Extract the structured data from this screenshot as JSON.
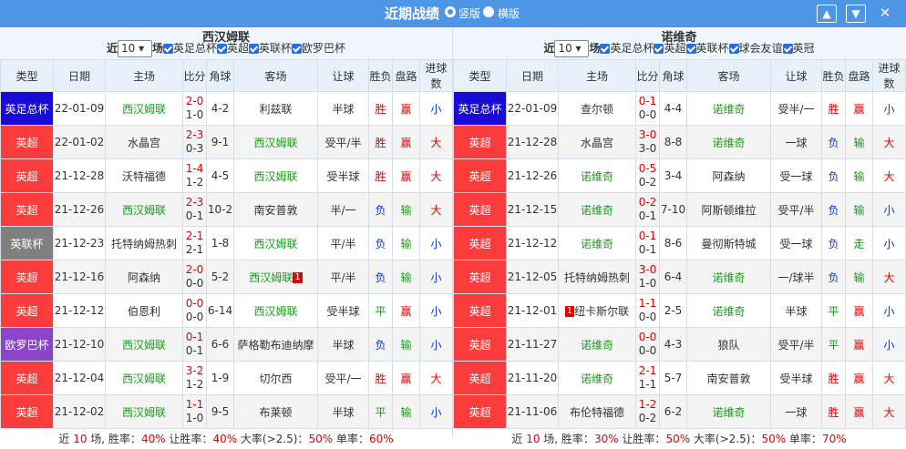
{
  "header": {
    "title": "近期战绩",
    "view_vertical": "竖版",
    "view_horizontal": "横版",
    "btn_up": "▲",
    "btn_down": "▼",
    "btn_close": "✕"
  },
  "columns": [
    "类型",
    "日期",
    "主场",
    "比分",
    "角球",
    "客场",
    "让球",
    "胜负",
    "盘路",
    "进球数"
  ],
  "left": {
    "team": "西汉姆联",
    "filter": {
      "prefix": "近",
      "count": "10",
      "suffix": "场",
      "checks": [
        "英足总杯",
        "英超",
        "英联杯",
        "欧罗巴杯"
      ]
    },
    "rows": [
      {
        "type": "英足总杯",
        "tc": "t-fa",
        "date": "22-01-09",
        "home": "西汉姆联",
        "hg": true,
        "ft": "2-0",
        "ht": "1-0",
        "corner": "4-2",
        "away": "利兹联",
        "ag": false,
        "hc": "半球",
        "wl": "胜",
        "wlc": "redc",
        "pl": "赢",
        "plc": "redc",
        "ou": "小",
        "ouc": "bluec"
      },
      {
        "type": "英超",
        "tc": "t-pl",
        "date": "22-01-02",
        "home": "水晶宫",
        "hg": false,
        "ft": "2-3",
        "ht": "0-3",
        "corner": "9-1",
        "away": "西汉姆联",
        "ag": true,
        "hc": "受平/半",
        "wl": "胜",
        "wlc": "redc",
        "pl": "赢",
        "plc": "redc",
        "ou": "大",
        "ouc": "redc"
      },
      {
        "type": "英超",
        "tc": "t-pl",
        "date": "21-12-28",
        "home": "沃特福德",
        "hg": false,
        "ft": "1-4",
        "ht": "1-2",
        "corner": "4-5",
        "away": "西汉姆联",
        "ag": true,
        "hc": "受半球",
        "wl": "胜",
        "wlc": "redc",
        "pl": "赢",
        "plc": "redc",
        "ou": "大",
        "ouc": "redc"
      },
      {
        "type": "英超",
        "tc": "t-pl",
        "date": "21-12-26",
        "home": "西汉姆联",
        "hg": true,
        "ft": "2-3",
        "ht": "0-1",
        "corner": "10-2",
        "away": "南安普敦",
        "ag": false,
        "hc": "半/一",
        "wl": "负",
        "wlc": "bluec",
        "pl": "输",
        "plc": "greenc",
        "ou": "大",
        "ouc": "redc"
      },
      {
        "type": "英联杯",
        "tc": "t-lc",
        "date": "21-12-23",
        "home": "托特纳姆热刺",
        "hg": false,
        "ft": "2-1",
        "ht": "2-1",
        "corner": "1-8",
        "away": "西汉姆联",
        "ag": true,
        "hc": "平/半",
        "wl": "负",
        "wlc": "bluec",
        "pl": "输",
        "plc": "greenc",
        "ou": "小",
        "ouc": "bluec"
      },
      {
        "type": "英超",
        "tc": "t-pl",
        "date": "21-12-16",
        "home": "阿森纳",
        "hg": false,
        "ft": "2-0",
        "ht": "0-0",
        "corner": "5-2",
        "away": "西汉姆联",
        "ag": true,
        "card": "1",
        "hc": "平/半",
        "wl": "负",
        "wlc": "bluec",
        "pl": "输",
        "plc": "greenc",
        "ou": "小",
        "ouc": "bluec"
      },
      {
        "type": "英超",
        "tc": "t-pl",
        "date": "21-12-12",
        "home": "伯恩利",
        "hg": false,
        "ft": "0-0",
        "ht": "0-0",
        "corner": "6-14",
        "away": "西汉姆联",
        "ag": true,
        "hc": "受半球",
        "wl": "平",
        "wlc": "greenc",
        "pl": "赢",
        "plc": "redc",
        "ou": "小",
        "ouc": "bluec"
      },
      {
        "type": "欧罗巴杯",
        "tc": "t-el",
        "date": "21-12-10",
        "home": "西汉姆联",
        "hg": true,
        "ft": "0-1",
        "ht": "0-1",
        "corner": "6-6",
        "away": "萨格勒布迪纳摩",
        "ag": false,
        "hc": "半球",
        "wl": "负",
        "wlc": "bluec",
        "pl": "输",
        "plc": "greenc",
        "ou": "小",
        "ouc": "bluec"
      },
      {
        "type": "英超",
        "tc": "t-pl",
        "date": "21-12-04",
        "home": "西汉姆联",
        "hg": true,
        "ft": "3-2",
        "ht": "1-2",
        "corner": "1-9",
        "away": "切尔西",
        "ag": false,
        "hc": "受平/一",
        "wl": "胜",
        "wlc": "redc",
        "pl": "赢",
        "plc": "redc",
        "ou": "大",
        "ouc": "redc"
      },
      {
        "type": "英超",
        "tc": "t-pl",
        "date": "21-12-02",
        "home": "西汉姆联",
        "hg": true,
        "ft": "1-1",
        "ht": "1-0",
        "corner": "9-5",
        "away": "布莱顿",
        "ag": false,
        "hc": "半球",
        "wl": "平",
        "wlc": "greenc",
        "pl": "输",
        "plc": "greenc",
        "ou": "小",
        "ouc": "bluec"
      }
    ],
    "footer": {
      "p1": "近 ",
      "n": "10",
      "p2": " 场, 胜率：",
      "win": "40%",
      "p3": " 让胜率：",
      "hcwin": "40%",
      "p4": " 大率(>2.5)：",
      "big": "50%",
      "p5": " 单率：",
      "odd": "60%"
    }
  },
  "right": {
    "team": "诺维奇",
    "filter": {
      "prefix": "近",
      "count": "10",
      "suffix": "场",
      "checks": [
        "英足总杯",
        "英超",
        "英联杯",
        "球会友谊",
        "英冠"
      ]
    },
    "rows": [
      {
        "type": "英足总杯",
        "tc": "t-fa",
        "date": "22-01-09",
        "home": "查尔顿",
        "hg": false,
        "ft": "0-1",
        "ht": "0-0",
        "corner": "4-4",
        "away": "诺维奇",
        "ag": true,
        "hc": "受半/一",
        "wl": "胜",
        "wlc": "redc",
        "pl": "赢",
        "plc": "redc",
        "ou": "小",
        "ouc": "bluec"
      },
      {
        "type": "英超",
        "tc": "t-pl",
        "date": "21-12-28",
        "home": "水晶宫",
        "hg": false,
        "ft": "3-0",
        "ht": "3-0",
        "corner": "8-8",
        "away": "诺维奇",
        "ag": true,
        "hc": "一球",
        "wl": "负",
        "wlc": "bluec",
        "pl": "输",
        "plc": "greenc",
        "ou": "大",
        "ouc": "redc"
      },
      {
        "type": "英超",
        "tc": "t-pl",
        "date": "21-12-26",
        "home": "诺维奇",
        "hg": true,
        "ft": "0-5",
        "ht": "0-2",
        "corner": "3-4",
        "away": "阿森纳",
        "ag": false,
        "hc": "受一球",
        "wl": "负",
        "wlc": "bluec",
        "pl": "输",
        "plc": "greenc",
        "ou": "大",
        "ouc": "redc"
      },
      {
        "type": "英超",
        "tc": "t-pl",
        "date": "21-12-15",
        "home": "诺维奇",
        "hg": true,
        "ft": "0-2",
        "ht": "0-1",
        "corner": "7-10",
        "away": "阿斯顿维拉",
        "ag": false,
        "hc": "受平/半",
        "wl": "负",
        "wlc": "bluec",
        "pl": "输",
        "plc": "greenc",
        "ou": "小",
        "ouc": "bluec"
      },
      {
        "type": "英超",
        "tc": "t-pl",
        "date": "21-12-12",
        "home": "诺维奇",
        "hg": true,
        "ft": "0-1",
        "ht": "0-1",
        "corner": "8-6",
        "away": "曼彻斯特城",
        "ag": false,
        "hc": "受一球",
        "wl": "负",
        "wlc": "bluec",
        "pl": "走",
        "plc": "greenc",
        "ou": "小",
        "ouc": "bluec"
      },
      {
        "type": "英超",
        "tc": "t-pl",
        "date": "21-12-05",
        "home": "托特纳姆热刺",
        "hg": false,
        "ft": "3-0",
        "ht": "1-0",
        "corner": "6-4",
        "away": "诺维奇",
        "ag": true,
        "hc": "一/球半",
        "wl": "负",
        "wlc": "bluec",
        "pl": "输",
        "plc": "greenc",
        "ou": "大",
        "ouc": "redc"
      },
      {
        "type": "英超",
        "tc": "t-pl",
        "date": "21-12-01",
        "home": "纽卡斯尔联",
        "hg": false,
        "card": "1",
        "ft": "1-1",
        "ht": "0-0",
        "corner": "2-5",
        "away": "诺维奇",
        "ag": true,
        "hc": "半球",
        "wl": "平",
        "wlc": "greenc",
        "pl": "赢",
        "plc": "redc",
        "ou": "小",
        "ouc": "bluec"
      },
      {
        "type": "英超",
        "tc": "t-pl",
        "date": "21-11-27",
        "home": "诺维奇",
        "hg": true,
        "ft": "0-0",
        "ht": "0-0",
        "corner": "4-3",
        "away": "狼队",
        "ag": false,
        "hc": "受平/半",
        "wl": "平",
        "wlc": "greenc",
        "pl": "赢",
        "plc": "redc",
        "ou": "小",
        "ouc": "bluec"
      },
      {
        "type": "英超",
        "tc": "t-pl",
        "date": "21-11-20",
        "home": "诺维奇",
        "hg": true,
        "ft": "2-1",
        "ht": "1-1",
        "corner": "5-7",
        "away": "南安普敦",
        "ag": false,
        "hc": "受半球",
        "wl": "胜",
        "wlc": "redc",
        "pl": "赢",
        "plc": "redc",
        "ou": "大",
        "ouc": "redc"
      },
      {
        "type": "英超",
        "tc": "t-pl",
        "date": "21-11-06",
        "home": "布伦特福德",
        "hg": false,
        "ft": "1-2",
        "ht": "0-2",
        "corner": "6-2",
        "away": "诺维奇",
        "ag": true,
        "hc": "一球",
        "wl": "胜",
        "wlc": "redc",
        "pl": "赢",
        "plc": "redc",
        "ou": "大",
        "ouc": "redc"
      }
    ],
    "footer": {
      "p1": "近 ",
      "n": "10",
      "p2": " 场, 胜率：",
      "win": "30%",
      "p3": " 让胜率：",
      "hcwin": "50%",
      "p4": " 大率(>2.5)：",
      "big": "50%",
      "p5": " 单率：",
      "odd": "70%"
    }
  }
}
